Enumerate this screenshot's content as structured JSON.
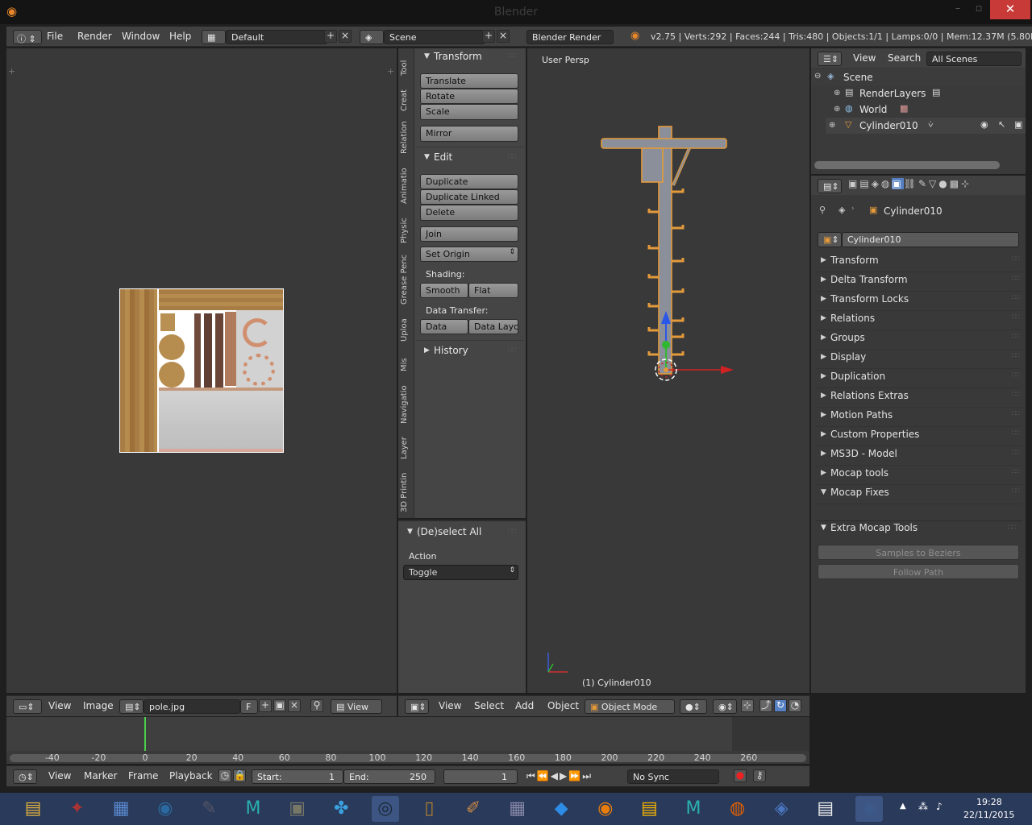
{
  "window": {
    "title": "Blender"
  },
  "infobar": {
    "menus": [
      "File",
      "Render",
      "Window",
      "Help"
    ],
    "layout": "Default",
    "scene": "Scene",
    "engine": "Blender Render",
    "stats": "v2.75 | Verts:292 | Faces:244 | Tris:480 | Objects:1/1 | Lamps:0/0 | Mem:12.37M (5.80M) | C"
  },
  "image_editor": {
    "header": {
      "view": "View",
      "image": "Image",
      "filename": "pole.jpg",
      "fake_user": "F",
      "view2": "View"
    }
  },
  "toolshelf": {
    "tabs": [
      "Tool",
      "Creat",
      "Relation",
      "Animatio",
      "Physic",
      "Grease Penc",
      "Uploa",
      "Mis",
      "Navigatio",
      "Layer",
      "3D Printin"
    ],
    "transform": {
      "title": "Transform",
      "translate": "Translate",
      "rotate": "Rotate",
      "scale": "Scale",
      "mirror": "Mirror"
    },
    "edit": {
      "title": "Edit",
      "duplicate": "Duplicate",
      "duplicate_linked": "Duplicate Linked",
      "delete": "Delete",
      "join": "Join",
      "set_origin": "Set Origin",
      "shading_label": "Shading:",
      "smooth": "Smooth",
      "flat": "Flat",
      "data_transfer_label": "Data Transfer:",
      "data": "Data",
      "data_layo": "Data Layo"
    },
    "history": {
      "title": "History"
    },
    "operator": {
      "title": "(De)select All",
      "action_label": "Action",
      "action_value": "Toggle"
    }
  },
  "viewport": {
    "label": "User Persp",
    "object_label": "(1) Cylinder010",
    "header": {
      "view": "View",
      "select": "Select",
      "add": "Add",
      "object": "Object",
      "mode": "Object Mode"
    }
  },
  "outliner": {
    "header": {
      "view": "View",
      "search": "Search",
      "filter": "All Scenes"
    },
    "items": [
      {
        "label": "Scene",
        "icon": "scene-icon"
      },
      {
        "label": "RenderLayers",
        "icon": "render-layers-icon"
      },
      {
        "label": "World",
        "icon": "world-icon"
      },
      {
        "label": "Cylinder010",
        "icon": "mesh-object-icon"
      }
    ]
  },
  "properties": {
    "breadcrumb": "Cylinder010",
    "object_name": "Cylinder010",
    "panels": [
      {
        "label": "Transform",
        "open": false
      },
      {
        "label": "Delta Transform",
        "open": false
      },
      {
        "label": "Transform Locks",
        "open": false
      },
      {
        "label": "Relations",
        "open": false
      },
      {
        "label": "Groups",
        "open": false
      },
      {
        "label": "Display",
        "open": false
      },
      {
        "label": "Duplication",
        "open": false
      },
      {
        "label": "Relations Extras",
        "open": false
      },
      {
        "label": "Motion Paths",
        "open": false
      },
      {
        "label": "Custom Properties",
        "open": false
      },
      {
        "label": "MS3D - Model",
        "open": false
      },
      {
        "label": "Mocap tools",
        "open": false
      },
      {
        "label": "Mocap Fixes",
        "open": true
      }
    ],
    "extra_panel": {
      "label": "Extra Mocap Tools",
      "samples": "Samples to Beziers",
      "follow": "Follow Path"
    }
  },
  "timeline": {
    "ticks": [
      "-40",
      "-20",
      "0",
      "20",
      "40",
      "60",
      "80",
      "100",
      "120",
      "140",
      "160",
      "180",
      "200",
      "220",
      "240",
      "260"
    ],
    "current_frame_marker": 0,
    "header": {
      "view": "View",
      "marker": "Marker",
      "frame": "Frame",
      "playback": "Playback",
      "start_label": "Start:",
      "start": "1",
      "end_label": "End:",
      "end": "250",
      "current": "1",
      "sync": "No Sync"
    }
  },
  "taskbar": {
    "apps": [
      "file-explorer-icon",
      "app-icon",
      "remote-desktop-icon",
      "wifi-tool-icon",
      "editor-icon",
      "maya-icon",
      "game-icon",
      "network-icon",
      "steam-icon",
      "door-app-icon",
      "pencil-app-icon",
      "calculator-icon",
      "dropbox-icon",
      "blender-icon",
      "slides-icon",
      "3ds-max-icon",
      "firefox-icon",
      "paint-icon",
      "notes-icon",
      "blender-active-icon"
    ],
    "time": "19:28",
    "date": "22/11/2015"
  },
  "colors": {
    "accent": "#5680c2",
    "close": "#c73a37",
    "header": "#414141",
    "editor_bg": "#393939",
    "outline_orange": "#e49a3a"
  }
}
